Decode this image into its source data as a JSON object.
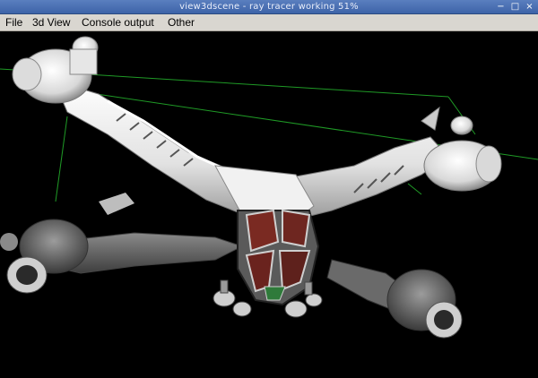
{
  "window": {
    "title": "view3dscene - ray tracer working 51%"
  },
  "menubar": {
    "items": [
      {
        "id": "file",
        "label": "File"
      },
      {
        "id": "3dview",
        "label": "3d View"
      },
      {
        "id": "console",
        "label": "Console output"
      },
      {
        "id": "other",
        "label": "Other"
      }
    ]
  },
  "title_buttons": {
    "minimize": "−",
    "maximize": "□",
    "close": "×"
  },
  "viewport": {
    "ray_tracer_progress": 0.51,
    "colors": {
      "background": "#000000",
      "bounding_box": "#1f9a26",
      "model_light": "#ececec",
      "model_mid": "#a9a9a9",
      "model_dark": "#585858",
      "cockpit_red": "#7a2a22",
      "cockpit_green": "#2f7a3a"
    }
  }
}
